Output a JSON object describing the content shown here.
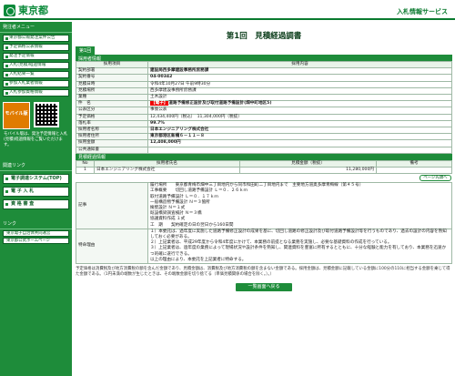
{
  "header": {
    "logo_text": "東京都",
    "system_title": "入札情報サービス"
  },
  "sidebar": {
    "menu_heading": "発注者メニュー",
    "items": [
      {
        "label": "東京都公報発注案件公告"
      },
      {
        "label": "予定価格公表情報"
      },
      {
        "label": "発注予定情報"
      },
      {
        "label": "入札(見積)経過情報"
      },
      {
        "label": "入札結果一覧"
      },
      {
        "label": "参加入札業者情報"
      },
      {
        "label": "入札参加資格情報"
      }
    ],
    "mobile_label": "モバイル版",
    "mobile_note": "モバイル版は、発注予定情報と入札(見積)経過情報をご覧いただけます。",
    "links_heading": "関連リンク",
    "big_links": [
      {
        "label": "電子調達システム(TOP)"
      },
      {
        "label": "電 子 入 札"
      },
      {
        "label": "資 格 審 査"
      }
    ],
    "other_heading": "リンク",
    "other_links": [
      {
        "label": "東京電子自治体共同運営"
      },
      {
        "label": "東京都公式ホームページ"
      }
    ]
  },
  "main": {
    "title": "第1回　見積経過調書",
    "round_tab": "第1回",
    "adopt_section": "採用者情報",
    "col_item": "採用項目",
    "col_content": "採用内容",
    "rows": [
      {
        "label": "契約部署",
        "value": "建設局西多摩建設事務所庶務課",
        "bold": true
      },
      {
        "label": "契約番号",
        "value": "04-00342",
        "bold": true
      },
      {
        "label": "見積日時",
        "value": "令和4年10月27日 午前9時30分",
        "bold": false
      },
      {
        "label": "見積場所",
        "value": "西多摩建設事務所庶務課",
        "bold": false
      },
      {
        "label": "業種",
        "value": "土木設計",
        "bold": false
      },
      {
        "label": "件　名",
        "value": "道路予備修正設計及び取付道路予備設計(畑中町地区5)",
        "tag": "【電子】",
        "bold": true
      },
      {
        "label": "公表区分",
        "value": "事後公表",
        "bold": false
      },
      {
        "label": "予定価格",
        "value": "12,434,400円（税込）　11,304,000円（税抜）",
        "bold": false
      },
      {
        "label": "落札率",
        "value": "99.7%",
        "bold": true
      },
      {
        "label": "採用者名称",
        "value": "日本エンジニアリング株式会社",
        "bold": true
      },
      {
        "label": "採用者住所",
        "value": "東京都港区新橋６－１１－８",
        "bold": true
      },
      {
        "label": "採用金額",
        "value": "12,408,000円",
        "bold": true
      },
      {
        "label": "公共通知書",
        "value": "",
        "bold": false
      }
    ],
    "estimate_section": "見積経過情報",
    "est_headers": {
      "no": "No",
      "name": "採用者氏名",
      "amount": "見積金額（税抜）",
      "note": "備考"
    },
    "est_rows": [
      {
        "no": "1",
        "name": "日本エンジニアリング株式会社",
        "amount": "11,280,000円",
        "note": ""
      }
    ],
    "pill_label": "ページ先頭へ",
    "notes_label": "記事",
    "notes_text": [
      "履行場所　　東京都青梅市畑中三丁目地内から同市和田町二丁目地内まで　主要地方道奥多摩青梅線（第４５号）",
      "工事概要　　切回し道路予備設計 Ｌ＝０．２６ｋｍ",
      "取付道路予備設計 Ｌ＝０．１７ｋｍ",
      "一般構造物予備設計 Ｎ＝３箇所",
      "擁壁設計 Ｎ＝１式",
      "既設橋梁調査検討 Ｎ＝３橋",
      "協議資料作成 １式",
      "工　期　　契約確定の日の翌日から160日間"
    ],
    "special_label": "特命理由",
    "special_text": [
      "１）本委託は、過年度に実施した道路予備修正設計の成果を基に、切回し道路の修正設計及び取付道路予備設計等を行うものであり、過去の設計の内容を熟知しておく必要がある。",
      "２）上記業者は、平成29年度から令和4年度にかけて、本業務の前提となる業務を実施し、必要な基礎資料の作成を行っている。",
      "３）上記業者は、過年度の業務によって現場状況や設計条件を熟知し、関連資料を豊富に所有するとともに、十分な経験と能力を有しており、本業務を迅速かつ的確に遂行できる。",
      "以上の理由により、本委託を上記業者に特命する。"
    ],
    "footer_note": "予定価格は消費税及び地方消費税の額を含んだ金額であり、見積金額は、消費税及び地方消費税の額を含まない金額である。採用金額は、見積金額に記載している金額に100分の110に相当する金額を乗じて得た金額である。（1円未満の端数が生じたときは、その端数金額を切り捨てる（単価見積関係の場合を除く。）。）",
    "back_button": "一覧画面へ戻る"
  }
}
